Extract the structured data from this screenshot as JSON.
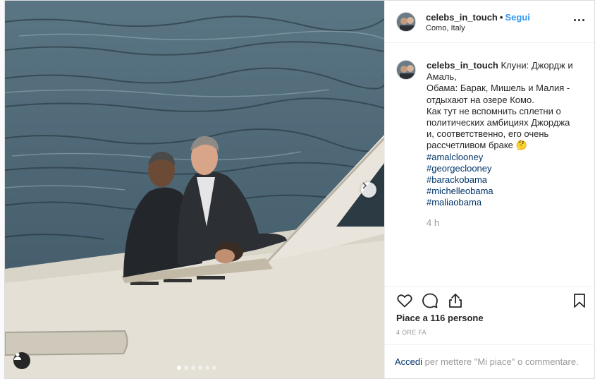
{
  "post": {
    "username": "celebs_in_touch",
    "separator": "•",
    "follow_label": "Segui",
    "location": "Como, Italy",
    "caption_lines": [
      "Клуни: Джордж и",
      "Амаль,",
      "Обама: Барак, Мишель и Малия -",
      "отдыхают на озере Комо.",
      "Как тут не вспомнить сплетни о",
      "политических амбициях Джорджа",
      "и, соответственно, его очень",
      "рассчетливом браке 🤔"
    ],
    "hashtags": [
      "#amalclooney",
      "#georgeclooney",
      "#barackobama",
      "#michelleobama",
      "#maliaobama"
    ],
    "time": "4 h",
    "likes_text": "Piace a 116 persone",
    "posted_ago": "4 ORE FA",
    "login_link": "Accedi",
    "login_rest": " per mettere \"Mi piace\" o commentare.",
    "carousel": {
      "count": 6,
      "active": 1
    }
  },
  "icons": {
    "more": "more-options-icon",
    "like": "heart-icon",
    "comment": "comment-bubble-icon",
    "share": "share-icon",
    "save": "bookmark-icon",
    "next": "chevron-right-icon",
    "user_tag": "user-tag-icon"
  },
  "colors": {
    "link": "#003569",
    "follow": "#3897f0",
    "muted": "#999999"
  }
}
